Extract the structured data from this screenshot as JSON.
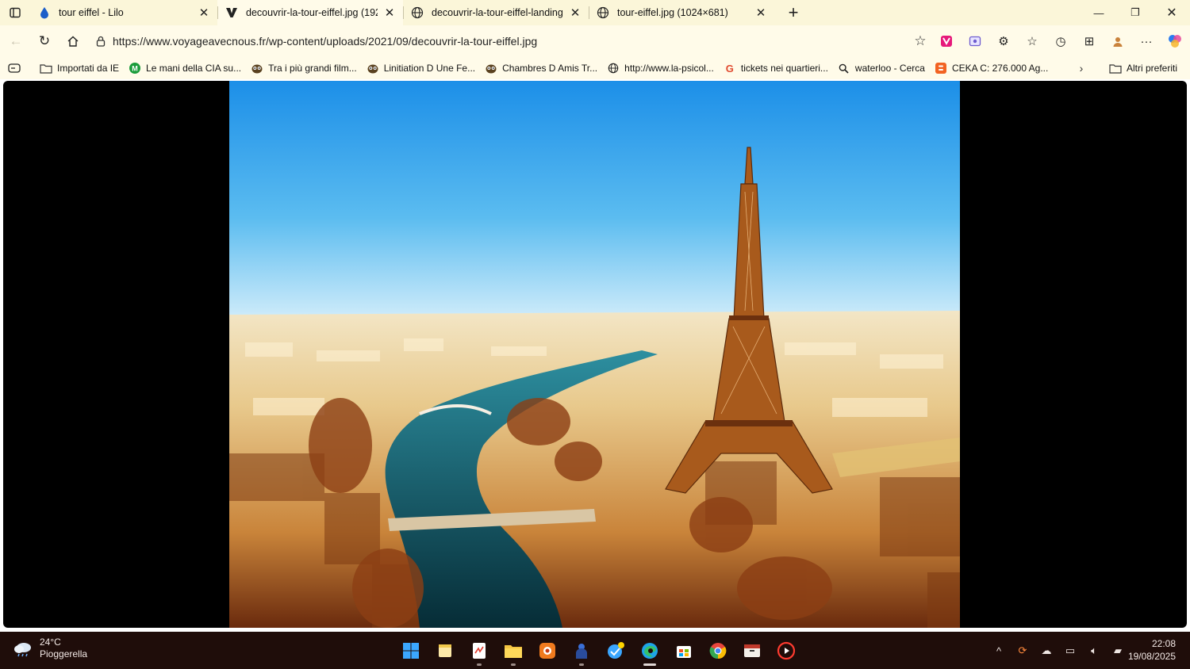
{
  "tabs": [
    {
      "title": "tour eiffel - Lilo",
      "favicon": "lilo-drop-icon",
      "active": false
    },
    {
      "title": "decouvrir-la-tour-eiffel.jpg (1920",
      "favicon": "v-logo-icon",
      "active": true
    },
    {
      "title": "decouvrir-la-tour-eiffel-landing.jp",
      "favicon": "globe-icon",
      "active": false
    },
    {
      "title": "tour-eiffel.jpg (1024×681)",
      "favicon": "globe-icon",
      "active": false
    }
  ],
  "address": {
    "url": "https://www.voyageavecnous.fr/wp-content/uploads/2021/09/decouvrir-la-tour-eiffel.jpg"
  },
  "favorites": [
    {
      "label": "Importati da IE",
      "icon": "folder-icon"
    },
    {
      "label": "Le mani della CIA su...",
      "icon": "m-green-icon"
    },
    {
      "label": "Tra i più grandi film...",
      "icon": "owl-icon"
    },
    {
      "label": "Linitiation D Une Fe...",
      "icon": "owl-icon"
    },
    {
      "label": "Chambres D Amis Tr...",
      "icon": "owl-icon"
    },
    {
      "label": "http://www.la-psicol...",
      "icon": "globe-icon"
    },
    {
      "label": "tickets nei quartieri...",
      "icon": "google-icon"
    },
    {
      "label": "waterloo - Cerca",
      "icon": "search-icon"
    },
    {
      "label": "CEKA C: 276.000 Ag...",
      "icon": "blogger-icon"
    }
  ],
  "other_favorites": "Altri preferiti",
  "weather": {
    "temp": "24°C",
    "condition": "Pioggerella"
  },
  "clock": {
    "time": "22:08",
    "date": "19/08/2025"
  },
  "colors": {
    "tabbar": "#fbf6d9",
    "toolbar": "#fffbe9",
    "taskbar": "#1f0d0a",
    "accent": "#1a73e8"
  }
}
